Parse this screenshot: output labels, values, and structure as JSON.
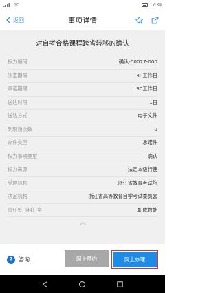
{
  "status": {
    "time": "17:39",
    "signal": "…"
  },
  "nav": {
    "back_label": "返回",
    "title": "事项详情"
  },
  "heading": "对自考合格课程跨省转移的确认",
  "fields": [
    {
      "key": "权力编码",
      "value": "确认-00027-000"
    },
    {
      "key": "法定期限",
      "value": "30工作日"
    },
    {
      "key": "承诺期限",
      "value": "30工作日"
    },
    {
      "key": "送达时限",
      "value": "1日"
    },
    {
      "key": "送达方式",
      "value": "电子文件"
    },
    {
      "key": "到现场次数",
      "value": "0"
    },
    {
      "key": "办件类型",
      "value": "承诺件"
    },
    {
      "key": "权力事项类型",
      "value": "确认"
    },
    {
      "key": "权力来源",
      "value": "法定本级行使"
    },
    {
      "key": "受理机构",
      "value": "浙江省教育考试院"
    },
    {
      "key": "决定机构",
      "value": "浙江省高等教育自学考试委员会"
    },
    {
      "key": "责任处（科）室",
      "value": "职成教处"
    }
  ],
  "actions": {
    "consult_label": "咨询",
    "reserve_label": "网上预约",
    "online_label": "网上办理"
  },
  "colors": {
    "accent": "#1e8ce6",
    "highlight_border": "#e0302a",
    "disabled": "#a8a8a8"
  }
}
